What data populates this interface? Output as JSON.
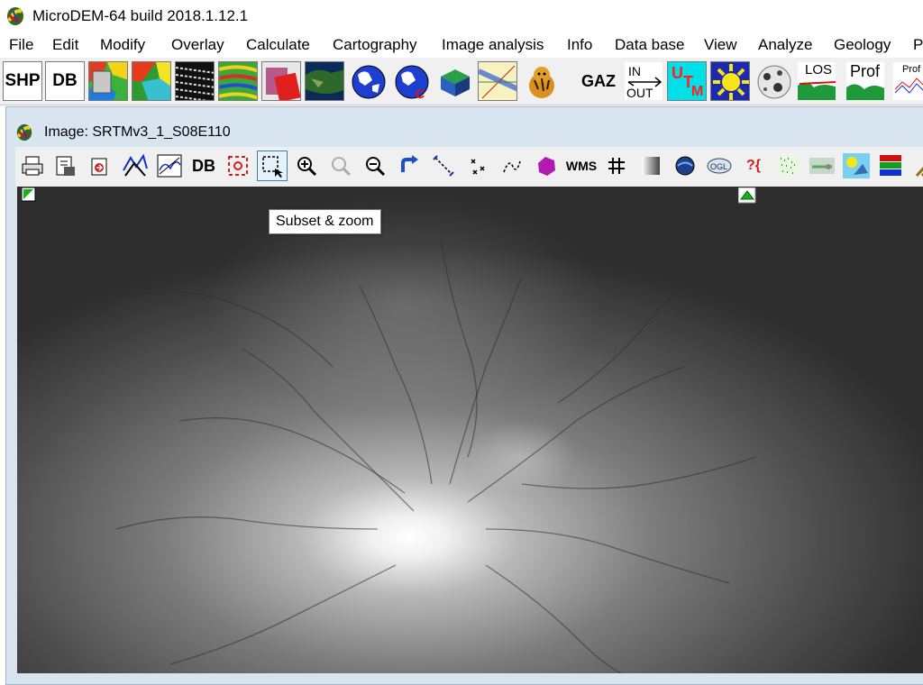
{
  "app": {
    "title": "MicroDEM-64 build 2018.1.12.1",
    "icon": "microdem-logo-icon"
  },
  "menu": {
    "items": [
      "File",
      "Edit",
      "Modify",
      "Overlay",
      "Calculate",
      "Cartography",
      "Image analysis",
      "Info",
      "Data base",
      "View",
      "Analyze",
      "Geology",
      "P"
    ]
  },
  "main_toolbar": {
    "shp_label": "SHP",
    "db_label": "DB",
    "gaz_label": "GAZ",
    "in_label": "IN",
    "out_label": "OUT",
    "utm_u": "U",
    "utm_t": "T",
    "utm_m": "M",
    "los_label": "LOS",
    "prof_label": "Prof",
    "prof_small_label": "Prof"
  },
  "image_window": {
    "title": "Image: SRTMv3_1_S08E110",
    "toolbar": {
      "db_label": "DB",
      "wms_label": "WMS",
      "query_label": "?{"
    },
    "tooltip": "Subset & zoom"
  },
  "colors": {
    "child_window_frame": "#d9e4f1",
    "toolbar_bg": "#f0f0f0",
    "hot_button_border": "#3c7fb1",
    "utm_bg": "#00e0e8",
    "utm_letters": "#ff2020"
  }
}
